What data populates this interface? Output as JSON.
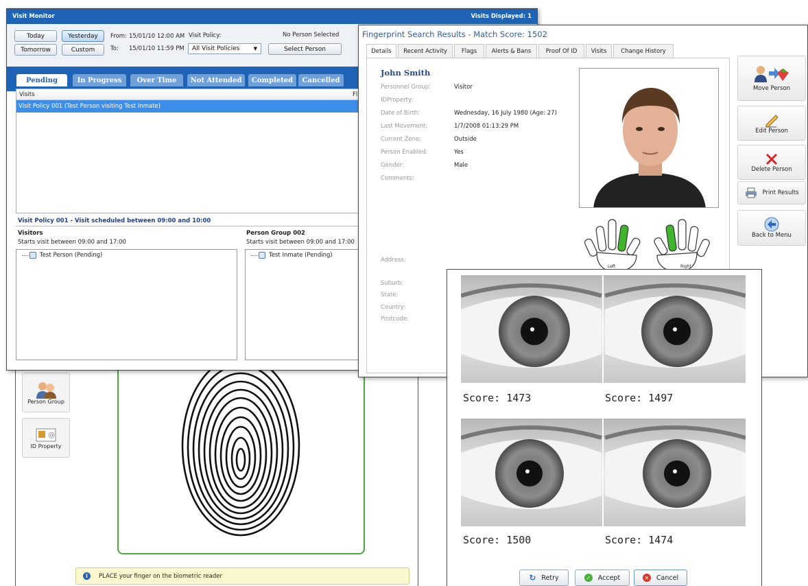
{
  "visit_monitor": {
    "title": "Visit Monitor",
    "visits_displayed": "Visits Displayed: 1",
    "buttons": {
      "today": "Today",
      "yesterday": "Yesterday",
      "tomorrow": "Tomorrow",
      "custom": "Custom"
    },
    "from_label": "From:",
    "from_value": "15/01/10 12:00 AM",
    "to_label": "To:",
    "to_value": "15/01/10 11:59 PM",
    "visit_policy_label": "Visit Policy:",
    "visit_policy_value": "All Visit Policies",
    "no_person": "No Person Selected",
    "select_person": "Select Person",
    "tabs": [
      "Pending",
      "In Progress",
      "Over Time",
      "Not Attended",
      "Completed",
      "Cancelled"
    ],
    "list_header": "Visits",
    "list_header_right": "Fl",
    "selected_row": "Visit Policy 001 (Test Person visiting Test Inmate)",
    "detail_title": "Visit Policy 001 - Visit scheduled between 09:00 and 10:00",
    "visitors_title": "Visitors",
    "visitors_sub": "Starts visit between 09:00 and 17:00",
    "visitor_item": "Test Person (Pending)",
    "group_title": "Person Group 002",
    "group_sub": "Starts visit between 09:00 and 17:00",
    "group_item": "Test Inmate (Pending)"
  },
  "side_tiles": {
    "person_group": "Person Group",
    "id_property": "ID Property"
  },
  "fingerprint_hint": "PLACE your finger on the biometric reader",
  "search_results": {
    "title": "Fingerprint Search Results - Match Score: 1502",
    "tabs": [
      "Details",
      "Recent Activity",
      "Flags",
      "Alerts & Bans",
      "Proof Of ID",
      "Visits",
      "Change History"
    ],
    "name": "John Smith",
    "fields": [
      {
        "k": "Personnel Group:",
        "v": "Visitor"
      },
      {
        "k": "IDProperty:",
        "v": ""
      },
      {
        "k": "Date of Birth:",
        "v": "Wednesday, 16 July 1980   (Age: 27)"
      },
      {
        "k": "Last Movement:",
        "v": "1/7/2008 01:13:29 PM"
      },
      {
        "k": "Current Zone:",
        "v": "Outside"
      },
      {
        "k": "Person Enabled:",
        "v": "Yes"
      },
      {
        "k": "Gender:",
        "v": "Male"
      },
      {
        "k": "Comments:",
        "v": ""
      }
    ],
    "address_fields": [
      "Address:",
      "Suburb:",
      "State:",
      "Country:",
      "Postcode:"
    ],
    "hand_left": "Left",
    "hand_right": "Right",
    "actions": [
      "Move Person",
      "Edit Person",
      "Delete Person",
      "Print Results",
      "Back to Menu"
    ]
  },
  "iris": {
    "scores": [
      "Score: 1473",
      "Score: 1497",
      "Score: 1500",
      "Score: 1474"
    ],
    "buttons": [
      "Retry",
      "Accept",
      "Cancel"
    ]
  },
  "colors": {
    "accent": "#1f63b6",
    "match_finger": "#3fb42c",
    "ok_border": "#4aa83c"
  }
}
